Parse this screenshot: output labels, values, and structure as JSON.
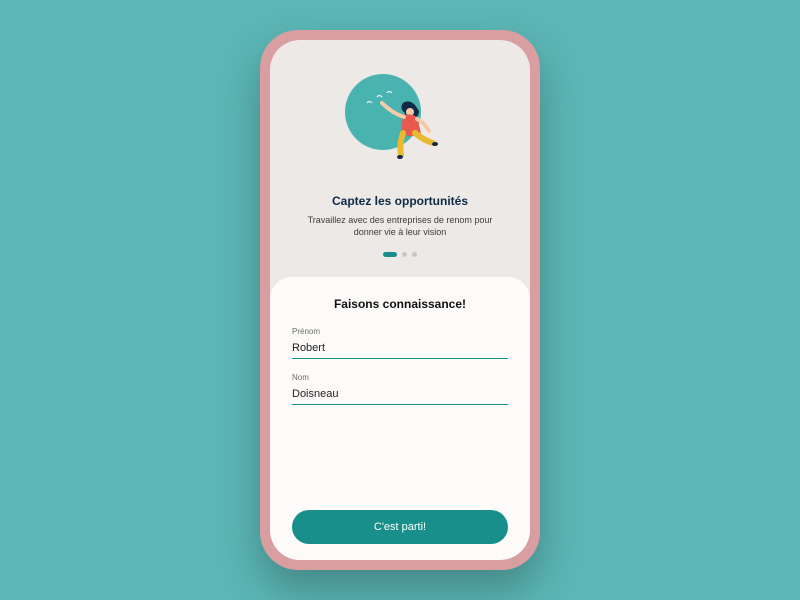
{
  "hero": {
    "title": "Captez les opportunités",
    "subtitle": "Travaillez avec des entreprises de renom pour donner vie à leur vision"
  },
  "pager": {
    "active_index": 0,
    "count": 3
  },
  "form": {
    "title": "Faisons connaissance!",
    "first_name_label": "Prénom",
    "first_name_value": "Robert",
    "last_name_label": "Nom",
    "last_name_value": "Doisneau",
    "submit_label": "C'est parti!"
  },
  "colors": {
    "background": "#5bb6b5",
    "phone_frame": "#d99ea0",
    "accent": "#188f8b"
  }
}
